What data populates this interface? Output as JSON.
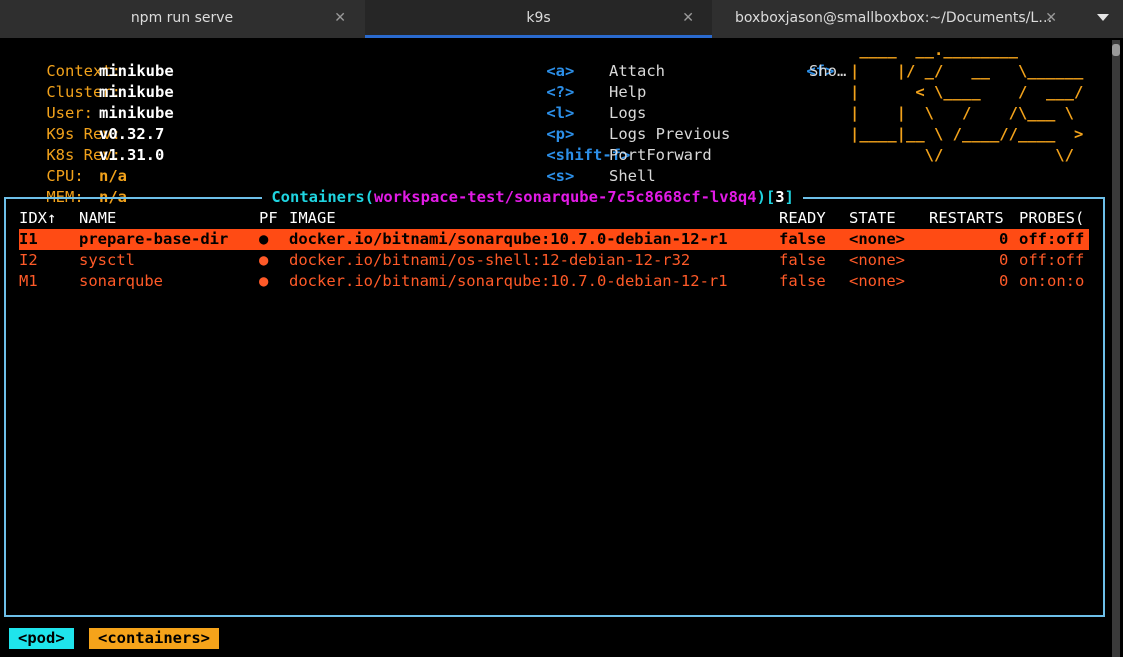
{
  "tabs": [
    {
      "label": "npm run serve",
      "active": false
    },
    {
      "label": "k9s",
      "active": true
    },
    {
      "label": "boxboxjason@smallboxbox:~/Documents/L…",
      "active": false
    }
  ],
  "tab_close_glyph": "✕",
  "info": [
    {
      "key": "Context:",
      "value": "minikube"
    },
    {
      "key": "Cluster:",
      "value": "minikube"
    },
    {
      "key": "User:",
      "value": "minikube"
    },
    {
      "key": "K9s Rev:",
      "value": "v0.32.7"
    },
    {
      "key": "K8s Rev:",
      "value": "v1.31.0"
    },
    {
      "key": "CPU:",
      "value": "n/a"
    },
    {
      "key": "MEM:",
      "value": "n/a"
    }
  ],
  "shortcuts": [
    {
      "key": "<a>",
      "label": "Attach"
    },
    {
      "key": "<?>",
      "label": "Help"
    },
    {
      "key": "<l>",
      "label": "Logs"
    },
    {
      "key": "<p>",
      "label": "Logs Previous"
    },
    {
      "key": "<shift-f>",
      "label": "PortForward"
    },
    {
      "key": "<s>",
      "label": "Shell"
    }
  ],
  "extra_shortcut": {
    "key": "<f>",
    "label": "Sho…"
  },
  "logo_lines": [
    " ____  __.________",
    "|    |/ _/   __   \\______",
    "|      < \\____    /  ___/",
    "|    |  \\   /    /\\___ \\",
    "|____|__ \\ /____//____  >",
    "        \\/            \\/"
  ],
  "view": {
    "title_prefix": " Containers(",
    "title_path": "workspace-test/sonarqube-7c5c8668cf-lv8q4",
    "title_close": ")[",
    "count": "3",
    "title_end": "] "
  },
  "columns": {
    "idx": "IDX↑",
    "name": "NAME",
    "pf": "PF",
    "image": "IMAGE",
    "ready": "READY",
    "state": "STATE",
    "restarts": "RESTARTS",
    "probes": "PROBES("
  },
  "rows": [
    {
      "idx": "I1",
      "name": "prepare-base-dir",
      "pf": "●",
      "image": "docker.io/bitnami/sonarqube:10.7.0-debian-12-r1",
      "ready": "false",
      "state": "<none>",
      "restarts": "0",
      "probes": "off:off",
      "selected": true
    },
    {
      "idx": "I2",
      "name": "sysctl",
      "pf": "●",
      "image": "docker.io/bitnami/os-shell:12-debian-12-r32",
      "ready": "false",
      "state": "<none>",
      "restarts": "0",
      "probes": "off:off",
      "selected": false
    },
    {
      "idx": "M1",
      "name": "sonarqube",
      "pf": "●",
      "image": "docker.io/bitnami/sonarqube:10.7.0-debian-12-r1",
      "ready": "false",
      "state": "<none>",
      "restarts": "0",
      "probes": "on:on:o",
      "selected": false
    }
  ],
  "breadcrumbs": [
    {
      "label": "<pod>",
      "color": "#1fe4ec"
    },
    {
      "label": "<containers>",
      "color": "#f5a31a"
    }
  ],
  "colors": {
    "accent_orange": "#f2a21b",
    "border_cyan": "#6dbfe8",
    "selection": "#ff4b14",
    "shortcut_blue": "#2c8fe8",
    "title_magenta": "#e21be6"
  }
}
